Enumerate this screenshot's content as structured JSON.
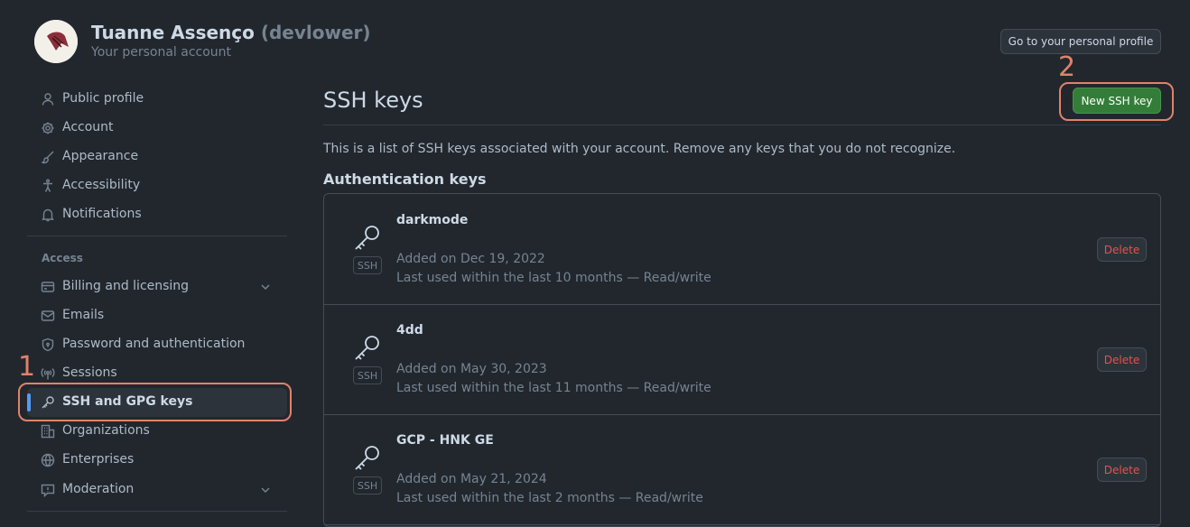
{
  "header": {
    "name": "Tuanne Assenço",
    "handle": "(devlower)",
    "subtitle": "Your personal account",
    "profile_button": "Go to your personal profile"
  },
  "sidebar": {
    "items": [
      {
        "label": "Public profile",
        "icon": "person-icon"
      },
      {
        "label": "Account",
        "icon": "gear-icon"
      },
      {
        "label": "Appearance",
        "icon": "paintbrush-icon"
      },
      {
        "label": "Accessibility",
        "icon": "accessibility-icon"
      },
      {
        "label": "Notifications",
        "icon": "bell-icon"
      }
    ],
    "access_heading": "Access",
    "access_items": [
      {
        "label": "Billing and licensing",
        "icon": "credit-card-icon",
        "expandable": true
      },
      {
        "label": "Emails",
        "icon": "mail-icon"
      },
      {
        "label": "Password and authentication",
        "icon": "shield-lock-icon"
      },
      {
        "label": "Sessions",
        "icon": "broadcast-icon"
      },
      {
        "label": "SSH and GPG keys",
        "icon": "key-icon",
        "active": true
      },
      {
        "label": "Organizations",
        "icon": "organization-icon"
      },
      {
        "label": "Enterprises",
        "icon": "globe-icon"
      },
      {
        "label": "Moderation",
        "icon": "report-icon",
        "expandable": true
      }
    ]
  },
  "annotations": {
    "one": "1",
    "two": "2"
  },
  "main": {
    "title": "SSH keys",
    "new_key_button": "New SSH key",
    "description": "This is a list of SSH keys associated with your account. Remove any keys that you do not recognize.",
    "auth_heading": "Authentication keys",
    "keys": [
      {
        "name": "darkmode",
        "type": "SSH",
        "added": "Added on Dec 19, 2022",
        "last_used": "Last used within the last 10 months — Read/write",
        "delete": "Delete"
      },
      {
        "name": "4dd",
        "type": "SSH",
        "added": "Added on May 30, 2023",
        "last_used": "Last used within the last 11 months — Read/write",
        "delete": "Delete"
      },
      {
        "name": "GCP - HNK GE",
        "type": "SSH",
        "added": "Added on May 21, 2024",
        "last_used": "Last used within the last 2 months — Read/write",
        "delete": "Delete"
      }
    ]
  },
  "colors": {
    "background": "#22272e",
    "accent_green": "#347d39",
    "danger": "#e5534b",
    "annotation": "#e0826a",
    "active_indicator": "#539bf5"
  }
}
